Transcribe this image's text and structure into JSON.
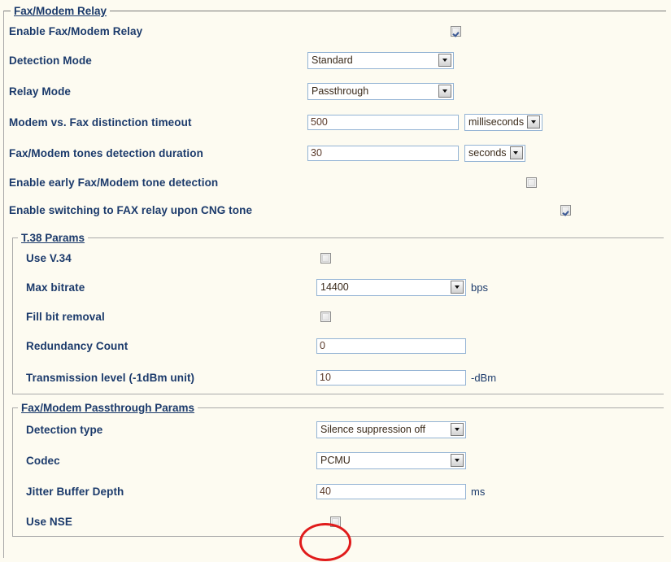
{
  "page": {
    "background_color": "#fdfbf1",
    "label_color": "#1b3a6b",
    "annotation_color": "#e01b1b"
  },
  "relay_section": {
    "legend": "Fax/Modem Relay",
    "rows": {
      "enable_relay": {
        "label": "Enable Fax/Modem Relay",
        "checked": true
      },
      "detection_mode": {
        "label": "Detection Mode",
        "value": "Standard"
      },
      "relay_mode": {
        "label": "Relay Mode",
        "value": "Passthrough"
      },
      "modem_fax_timeout": {
        "label": "Modem vs. Fax distinction timeout",
        "value": "500",
        "unit": "milliseconds"
      },
      "tones_detection_duration": {
        "label": "Fax/Modem tones detection duration",
        "value": "30",
        "unit": "seconds"
      },
      "early_tone_detection": {
        "label": "Enable early Fax/Modem tone detection",
        "checked": false
      },
      "cng_switching": {
        "label": "Enable switching to FAX relay upon CNG tone",
        "checked": true
      }
    }
  },
  "t38_section": {
    "legend": "T.38 Params",
    "rows": {
      "use_v34": {
        "label": "Use V.34",
        "checked": false
      },
      "max_bitrate": {
        "label": "Max bitrate",
        "value": "14400",
        "unit": "bps"
      },
      "fill_bit_removal": {
        "label": "Fill bit removal",
        "checked": false
      },
      "redundancy_count": {
        "label": "Redundancy Count",
        "value": "0"
      },
      "transmission_level": {
        "label": "Transmission level (-1dBm unit)",
        "value": "10",
        "unit": "-dBm"
      }
    }
  },
  "passthrough_section": {
    "legend": "Fax/Modem Passthrough Params",
    "rows": {
      "detection_type": {
        "label": "Detection type",
        "value": "Silence suppression off"
      },
      "codec": {
        "label": "Codec",
        "value": "PCMU"
      },
      "jitter_buffer_depth": {
        "label": "Jitter Buffer Depth",
        "value": "40",
        "unit": "ms"
      },
      "use_nse": {
        "label": "Use NSE",
        "checked": false
      }
    }
  },
  "annotation": {
    "name": "red-ellipse-highlight",
    "target": "use-nse-checkbox"
  }
}
